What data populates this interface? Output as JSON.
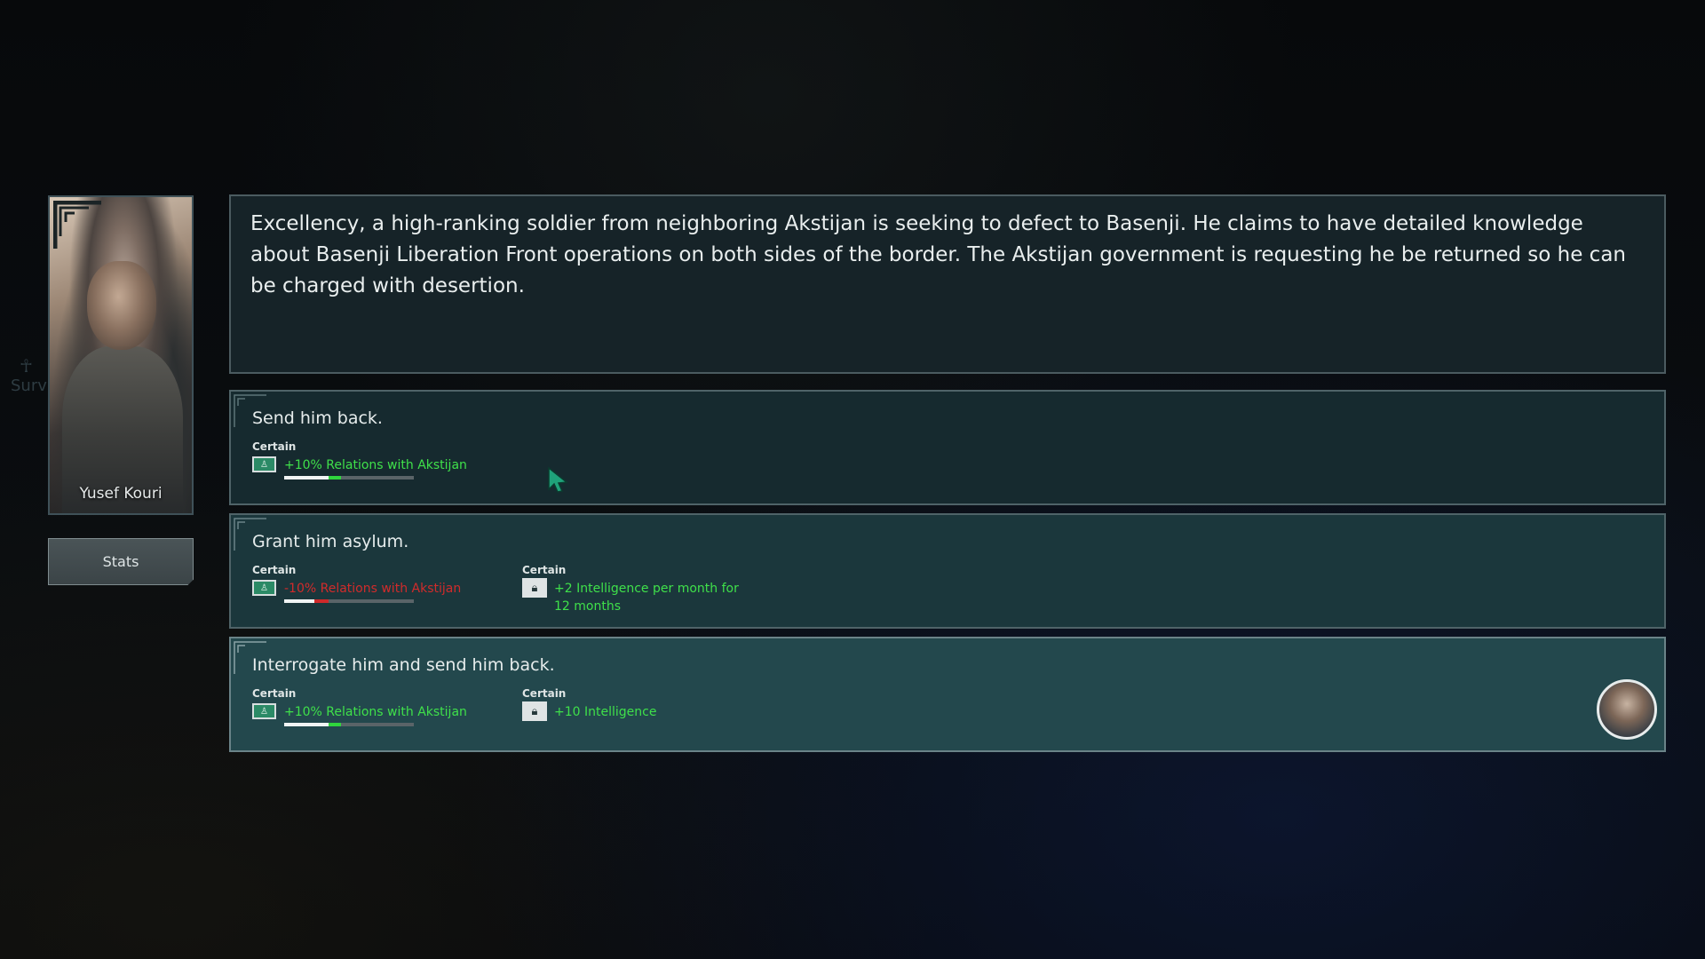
{
  "character": {
    "name": "Yusef Kouri",
    "stats_label": "Stats"
  },
  "side_hint": "Surv",
  "event": {
    "description": "Excellency, a high-ranking soldier from neighboring Akstijan is seeking to defect to Basenji.  He claims to have detailed knowledge about Basenji Liberation Front operations on both sides of the border.  The Akstijan government is requesting he be returned so he can be charged with desertion."
  },
  "options": [
    {
      "title": "Send him back.",
      "effects": [
        {
          "certainty": "Certain",
          "icon": "flag-icon",
          "text": "+10% Relations with Akstijan",
          "color": "#3fe04a",
          "relation_change": 10
        }
      ]
    },
    {
      "title": "Grant him asylum.",
      "effects": [
        {
          "certainty": "Certain",
          "icon": "flag-icon",
          "text": "-10% Relations with Akstijan",
          "color": "#d12b2b",
          "relation_change": -10
        },
        {
          "certainty": "Certain",
          "icon": "lock-icon",
          "text": "+2 Intelligence per month for 12 months",
          "color": "#3fe04a"
        }
      ]
    },
    {
      "title": "Interrogate him and send him back.",
      "effects": [
        {
          "certainty": "Certain",
          "icon": "flag-icon",
          "text": "+10% Relations with Akstijan",
          "color": "#3fe04a",
          "relation_change": 10
        },
        {
          "certainty": "Certain",
          "icon": "lock-icon",
          "text": "+10 Intelligence",
          "color": "#3fe04a"
        }
      ],
      "selected": true
    }
  ],
  "colors": {
    "positive": "#3fe04a",
    "negative": "#d12b2b",
    "panel_border": "#4b5b60"
  }
}
